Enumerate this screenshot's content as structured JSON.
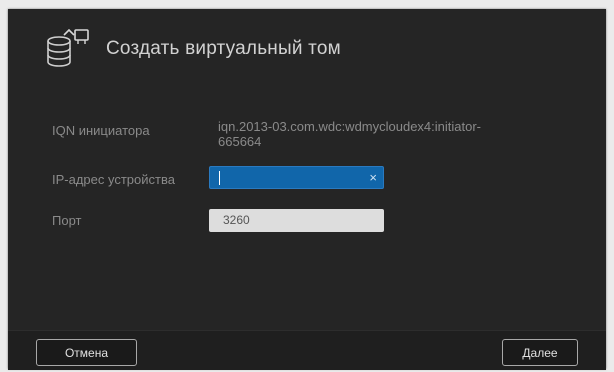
{
  "dialog": {
    "title": "Создать виртуальный том",
    "icon": "storage-database-icon"
  },
  "form": {
    "iqn_label": "IQN инициатора",
    "iqn_value": "iqn.2013-03.com.wdc:wdmycloudex4:initiator-665664",
    "ip_label": "IP-адрес устройства",
    "ip_value": "",
    "ip_clear_icon": "×",
    "port_label": "Порт",
    "port_value": "3260"
  },
  "footer": {
    "cancel_label": "Отмена",
    "next_label": "Далее"
  },
  "colors": {
    "background": "#252525",
    "active_input": "#1166aa",
    "button_border": "#a8a8a8"
  }
}
